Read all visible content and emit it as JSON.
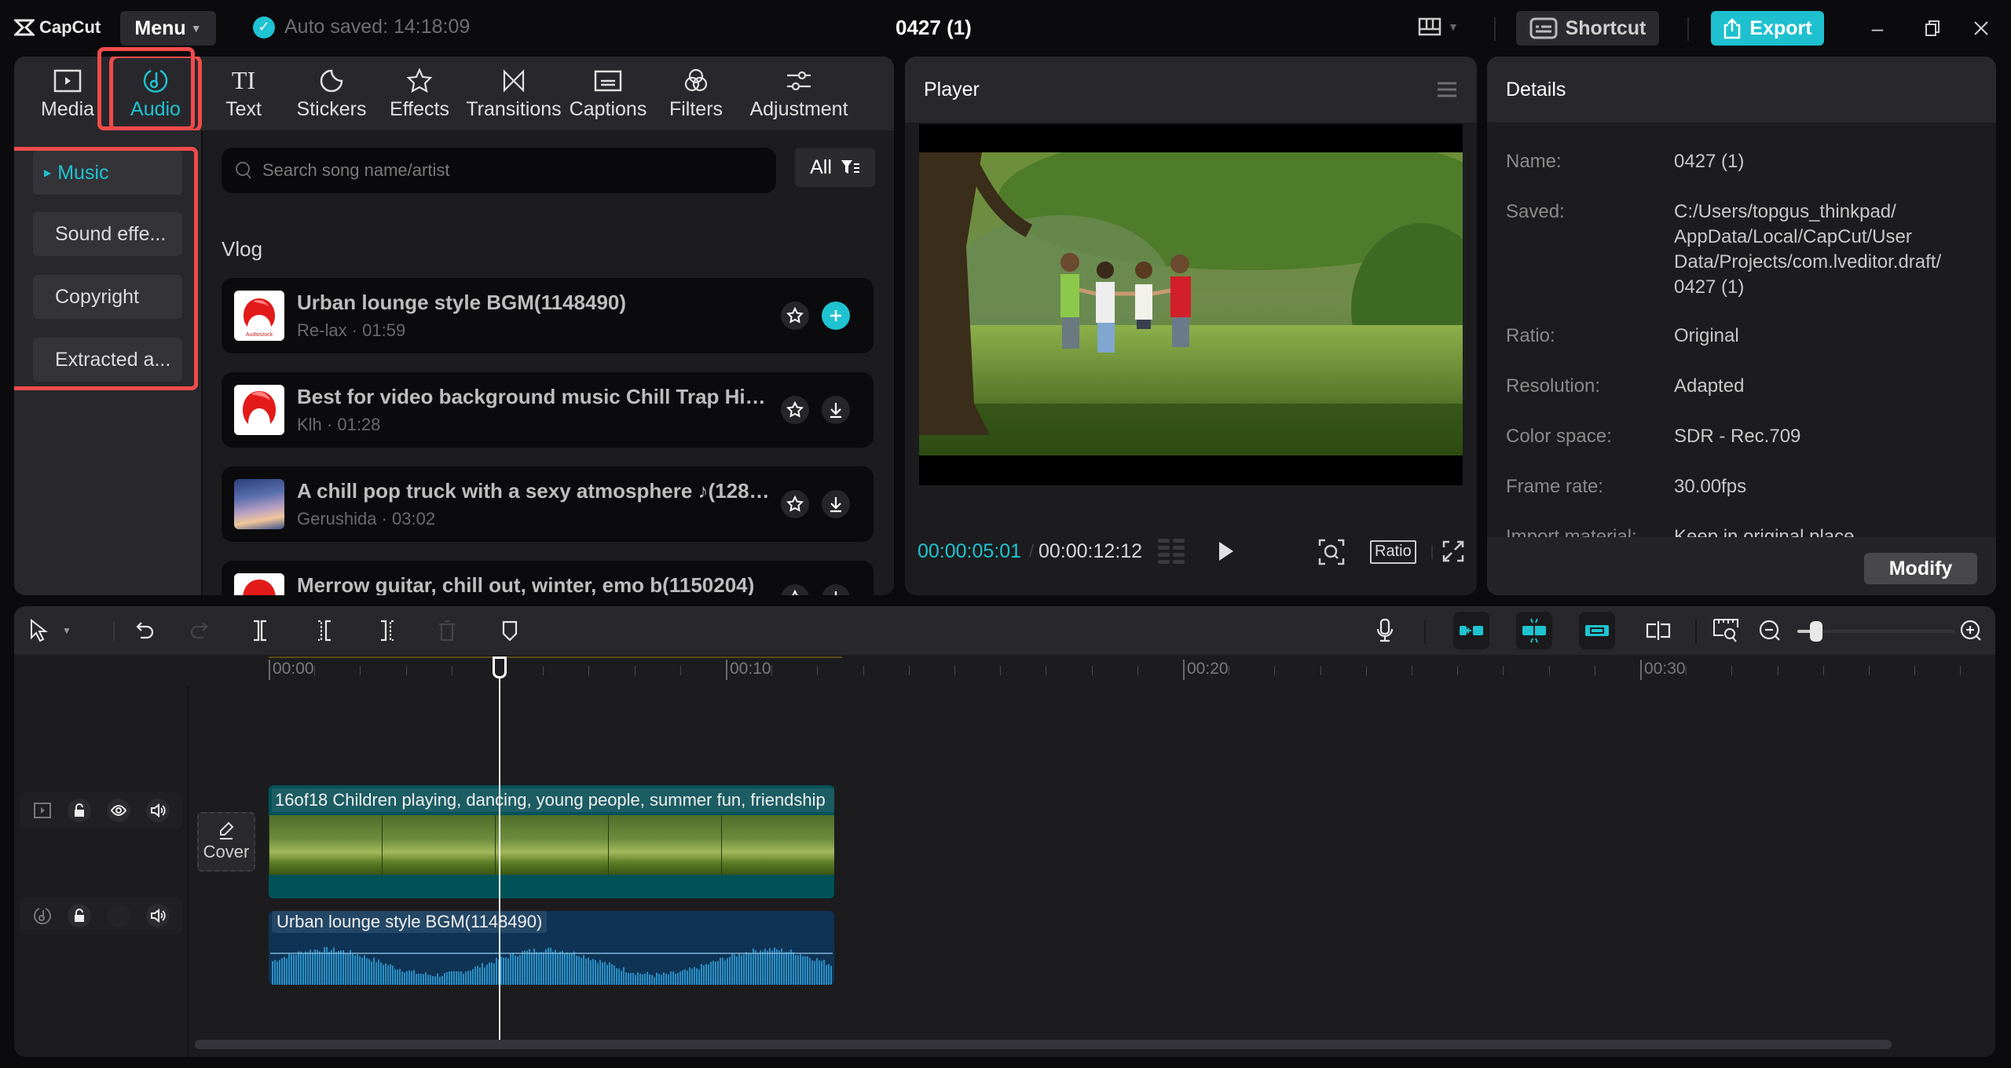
{
  "app": {
    "brand": "CapCut",
    "menu_label": "Menu",
    "autosave_text": "Auto saved: 14:18:09",
    "project_title": "0427 (1)",
    "shortcut_label": "Shortcut",
    "export_label": "Export",
    "accent_color": "#1fc3d1",
    "highlight_color": "#f04b4b"
  },
  "tabs": [
    {
      "label": "Media",
      "icon": "media-icon",
      "active": false
    },
    {
      "label": "Audio",
      "icon": "audio-note-icon",
      "active": true
    },
    {
      "label": "Text",
      "icon": "text-icon",
      "active": false
    },
    {
      "label": "Stickers",
      "icon": "sticker-icon",
      "active": false
    },
    {
      "label": "Effects",
      "icon": "effects-star-icon",
      "active": false
    },
    {
      "label": "Transitions",
      "icon": "transition-icon",
      "active": false
    },
    {
      "label": "Captions",
      "icon": "captions-icon",
      "active": false
    },
    {
      "label": "Filters",
      "icon": "filters-icon",
      "active": false
    },
    {
      "label": "Adjustment",
      "icon": "adjustment-sliders-icon",
      "active": false
    }
  ],
  "sidebar": {
    "items": [
      {
        "label": "Music",
        "active": true
      },
      {
        "label": "Sound effe...",
        "active": false
      },
      {
        "label": "Copyright",
        "active": false
      },
      {
        "label": "Extracted a...",
        "active": false
      }
    ]
  },
  "audio_library": {
    "search_placeholder": "Search song name/artist",
    "filter_label": "All",
    "section": "Vlog",
    "songs": [
      {
        "title": "Urban lounge style BGM(1148490)",
        "artist": "Re-lax",
        "duration": "01:59",
        "meta": "Re-lax · 01:59",
        "action": "add",
        "thumb_label": "Audiostock"
      },
      {
        "title": "Best for video background music Chill Trap Hip ...",
        "artist": "Klh",
        "duration": "01:28",
        "meta": "Klh · 01:28",
        "action": "download"
      },
      {
        "title": "A chill pop truck with a sexy atmosphere ♪(1285...",
        "artist": "Gerushida",
        "duration": "03:02",
        "meta": "Gerushida · 03:02",
        "action": "download"
      },
      {
        "title": "Merrow guitar, chill out, winter, emo b(1150204)",
        "artist": "",
        "duration": "",
        "meta": "",
        "action": "download"
      }
    ]
  },
  "player": {
    "title": "Player",
    "current_time": "00:00:05:01",
    "separator": "/",
    "total_time": "00:00:12:12",
    "ratio_label": "Ratio"
  },
  "details": {
    "title": "Details",
    "rows": [
      {
        "key": "Name:",
        "value": "0427 (1)"
      },
      {
        "key": "Saved:",
        "value": "C:/Users/topgus_thinkpad/ AppData/Local/CapCut/User Data/Projects/com.lveditor.draft/ 0427 (1)"
      },
      {
        "key": "Ratio:",
        "value": "Original"
      },
      {
        "key": "Resolution:",
        "value": "Adapted"
      },
      {
        "key": "Color space:",
        "value": "SDR - Rec.709"
      },
      {
        "key": "Frame rate:",
        "value": "30.00fps"
      },
      {
        "key": "Import material:",
        "value": "Keep in original place"
      }
    ],
    "modify_label": "Modify"
  },
  "timeline": {
    "ruler_labels": [
      "00:00",
      "00:10",
      "00:20",
      "00:30"
    ],
    "playhead_seconds": 5.03,
    "zoom_level": 0.08,
    "cover_label": "Cover",
    "video_clip": {
      "label": "16of18 Children playing, dancing, young people, summer fun, friendship"
    },
    "audio_clip": {
      "label": "Urban lounge style BGM(1148490)"
    }
  }
}
